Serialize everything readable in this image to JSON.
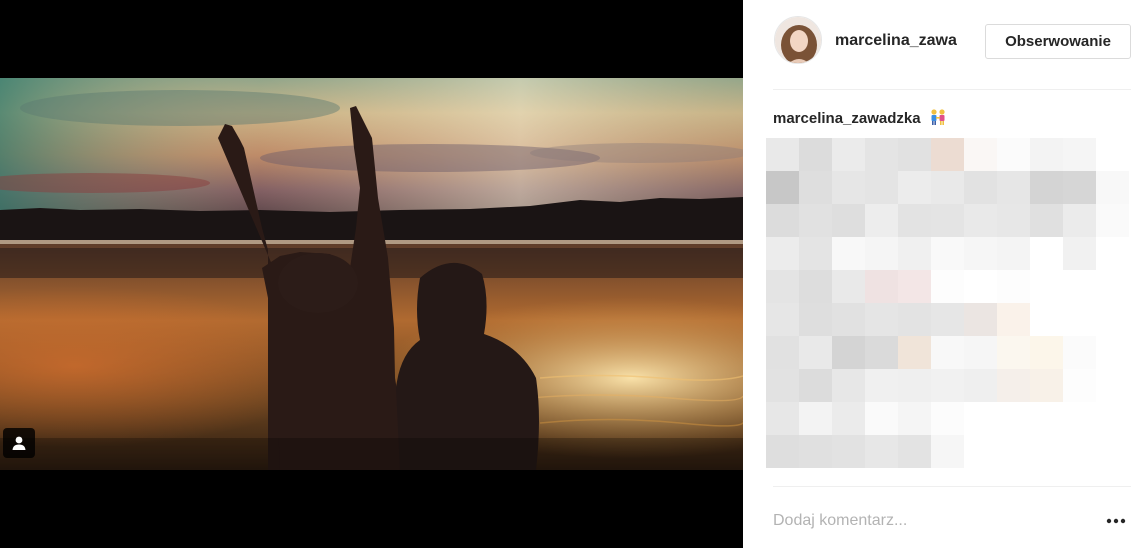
{
  "post": {
    "author_username": "marcelina_zawa",
    "follow_label": "Obserwowanie",
    "caption_username": "marcelina_zawadzka",
    "caption_emoji_icon": "couple-holding-hands-icon",
    "comment_placeholder": "Dodaj komentarz...",
    "more_options_icon": "more-options-icon",
    "user_tags_icon": "user-tag-icon"
  },
  "colors": {
    "text_primary": "#262626",
    "placeholder": "#b3b3b3",
    "border": "#dbdbdb",
    "divider": "#efefef",
    "media_background": "#000000"
  }
}
